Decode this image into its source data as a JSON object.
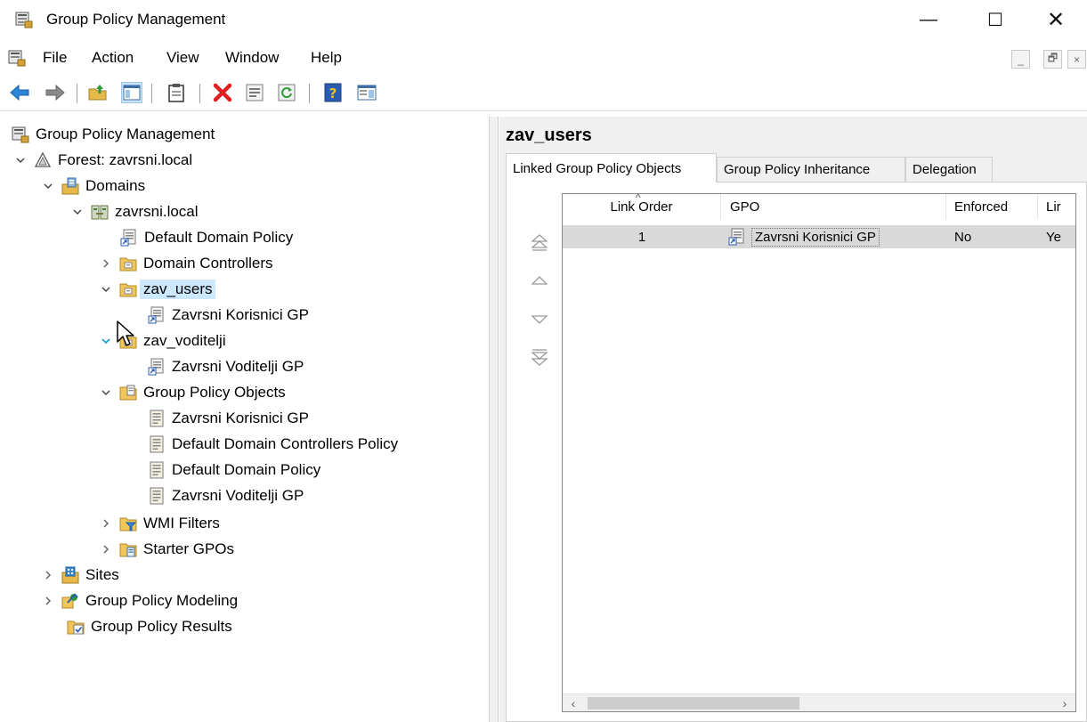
{
  "window": {
    "title": "Group Policy Management",
    "minimize_glyph": "—",
    "maximize_glyph": "☐",
    "close_glyph": "✕"
  },
  "menu": {
    "items": [
      "File",
      "Action",
      "View",
      "Window",
      "Help"
    ],
    "mdi_minimize": "_",
    "mdi_restore": "🗗",
    "mdi_close": "×"
  },
  "toolbar": {
    "icons": [
      "back-arrow-icon",
      "forward-arrow-icon",
      "up-folder-icon",
      "show-hide-tree-icon",
      "clipboard-icon",
      "delete-icon",
      "properties-icon",
      "refresh-icon",
      "help-icon",
      "action-pane-icon"
    ]
  },
  "tree": {
    "root": "Group Policy Management",
    "forest": "Forest: zavrsni.local",
    "domains": "Domains",
    "domain": "zavrsni.local",
    "default_domain_policy_link": "Default Domain Policy",
    "domain_controllers": "Domain Controllers",
    "zav_users": "zav_users",
    "zav_users_gpo": "Zavrsni Korisnici GP",
    "zav_voditelji": "zav_voditelji",
    "zav_voditelji_gpo": "Zavrsni Voditelji GP",
    "gpo_container": "Group Policy Objects",
    "gpos": [
      "Zavrsni Korisnici GP",
      "Default Domain Controllers Policy",
      "Default Domain Policy",
      "Zavrsni Voditelji GP"
    ],
    "wmi_filters": "WMI Filters",
    "starter_gpos": "Starter GPOs",
    "sites": "Sites",
    "modeling": "Group Policy Modeling",
    "results": "Group Policy Results"
  },
  "right": {
    "title": "zav_users",
    "tabs": [
      "Linked Group Policy Objects",
      "Group Policy Inheritance",
      "Delegation"
    ],
    "active_tab": 0,
    "columns": [
      "Link Order",
      "GPO",
      "Enforced",
      "Lir"
    ],
    "sort_indicator": "^",
    "rows": [
      {
        "link_order": "1",
        "gpo": "Zavrsni Korisnici GP",
        "enforced": "No",
        "link_enabled": "Ye"
      }
    ]
  },
  "colors": {
    "selection": "#cce8ff",
    "row_highlight": "#d9d9d9",
    "pane_bg": "#f0f0f0"
  }
}
